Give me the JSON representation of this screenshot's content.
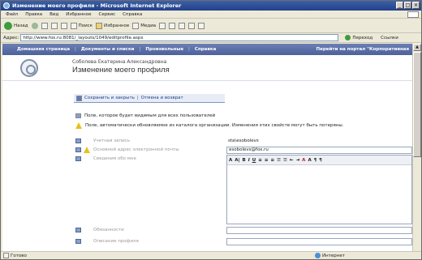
{
  "window": {
    "title": "Изменение моего профиля - Microsoft Internet Explorer",
    "controls": [
      "_",
      "□",
      "×"
    ]
  },
  "menu": [
    "Файл",
    "Правка",
    "Вид",
    "Избранное",
    "Сервис",
    "Справка"
  ],
  "toolbar": {
    "back": "Назад",
    "search": "Поиск",
    "favorites": "Избранное",
    "media": "Медиа"
  },
  "address": {
    "label": "Адрес:",
    "url": "http://www.fox.ru:8081/_layouts/1049/editprofile.aspx",
    "go": "Переход",
    "links": "Ссылки"
  },
  "site_nav": {
    "items": [
      "Домашняя страница",
      "Документы и списки",
      "Произвольные",
      "Справка"
    ],
    "right_link": "Перейти на портал \"Корпоративная"
  },
  "header": {
    "user_name": "Соболева Екатерина Александровна",
    "page_title": "Изменение моего профиля"
  },
  "actions": {
    "save": "Сохранить и закрыть",
    "cancel": "Отмена и возврат"
  },
  "notes": {
    "public": "Поле, которое будет видимым для всех пользователей",
    "imported": "Поле, автоматически обновляемое из каталога организации. Изменения этих свойств могут быть потеряны."
  },
  "fields": {
    "account_label": "Учетная запись",
    "account_value": "sta\\esobolevs",
    "email_label": "Основной адрес электронной почты",
    "email_value": "esobolevs@fox.ru",
    "about_label": "Сведения обо мне",
    "manager_label": "Обязанности",
    "dept_label": "Описание профиля"
  },
  "editor_toolbar": [
    "A",
    "A|",
    "B",
    "I",
    "U",
    "≡",
    "≡",
    "≡",
    "☰",
    "☰",
    "⇤",
    "⇥",
    "A",
    "A",
    "¶",
    "¶"
  ],
  "status": {
    "left": "Готово",
    "zone": "Интернет"
  }
}
